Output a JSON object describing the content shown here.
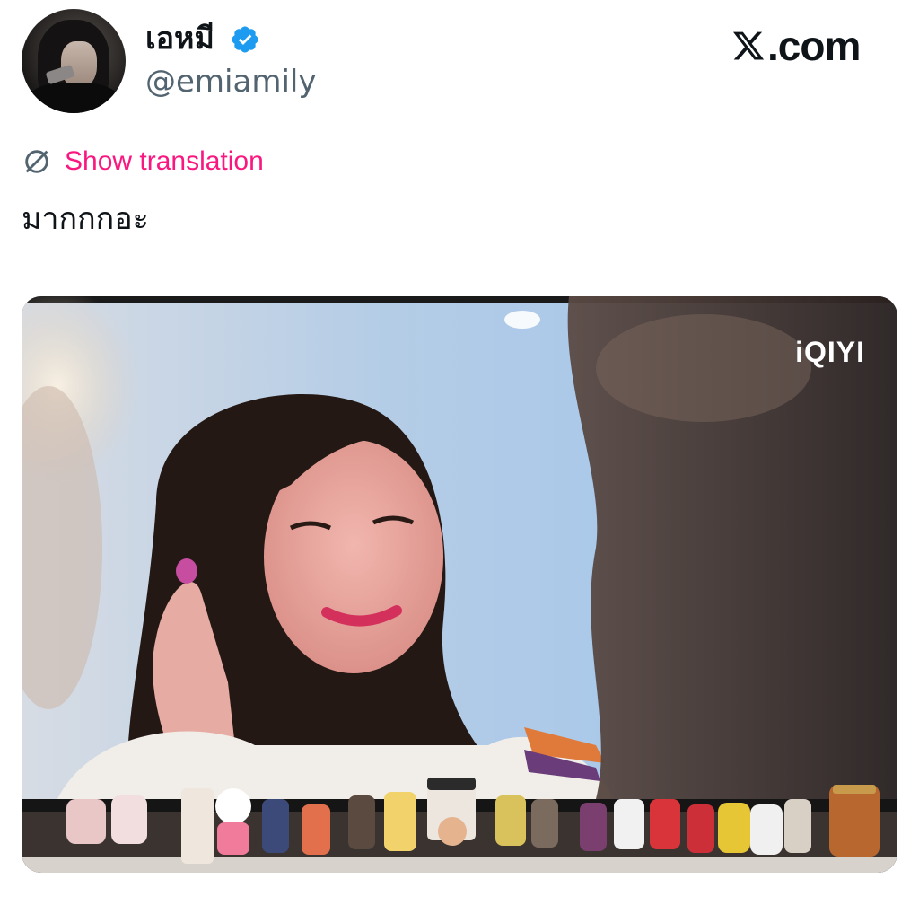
{
  "post": {
    "author": {
      "display_name": "เอหมี",
      "handle": "@emiamily",
      "verified": true,
      "avatar_icon": "avatar-image"
    },
    "brand": {
      "text": ".com",
      "icon": "x-logo-icon"
    },
    "translation_link": "Show translation",
    "text": "มากกกอะ",
    "media": {
      "watermark": "iQIYI",
      "icon": "photo"
    }
  },
  "colors": {
    "link": "#f91880",
    "verified": "#1d9bf0",
    "handle": "#536471",
    "text": "#0f1419"
  }
}
